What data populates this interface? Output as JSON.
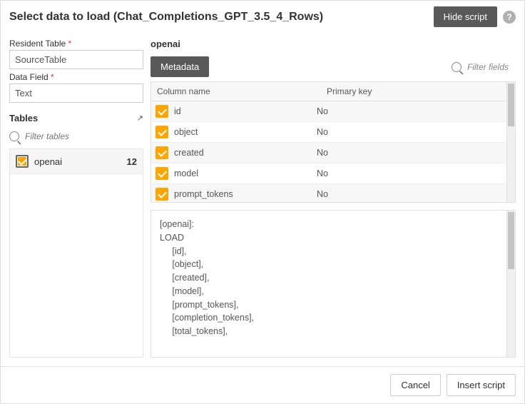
{
  "header": {
    "title": "Select data to load (Chat_Completions_GPT_3.5_4_Rows)",
    "hide_script_label": "Hide script",
    "help_glyph": "?"
  },
  "left": {
    "resident_table_label": "Resident Table",
    "resident_table_value": "SourceTable",
    "data_field_label": "Data Field",
    "data_field_value": "Text",
    "tables_section": "Tables",
    "expand_glyph": "↗",
    "filter_tables_placeholder": "Filter tables",
    "tables": [
      {
        "name": "openai",
        "count": "12",
        "checked": true
      }
    ]
  },
  "right": {
    "title": "openai",
    "metadata_label": "Metadata",
    "filter_fields_placeholder": "Filter fields",
    "col_header_name": "Column name",
    "col_header_pk": "Primary key",
    "columns": [
      {
        "name": "id",
        "pk": "No"
      },
      {
        "name": "object",
        "pk": "No"
      },
      {
        "name": "created",
        "pk": "No"
      },
      {
        "name": "model",
        "pk": "No"
      },
      {
        "name": "prompt_tokens",
        "pk": "No"
      }
    ],
    "script_text": "[openai]:\nLOAD\n     [id],\n     [object],\n     [created],\n     [model],\n     [prompt_tokens],\n     [completion_tokens],\n     [total_tokens],"
  },
  "footer": {
    "cancel_label": "Cancel",
    "insert_label": "Insert script"
  }
}
